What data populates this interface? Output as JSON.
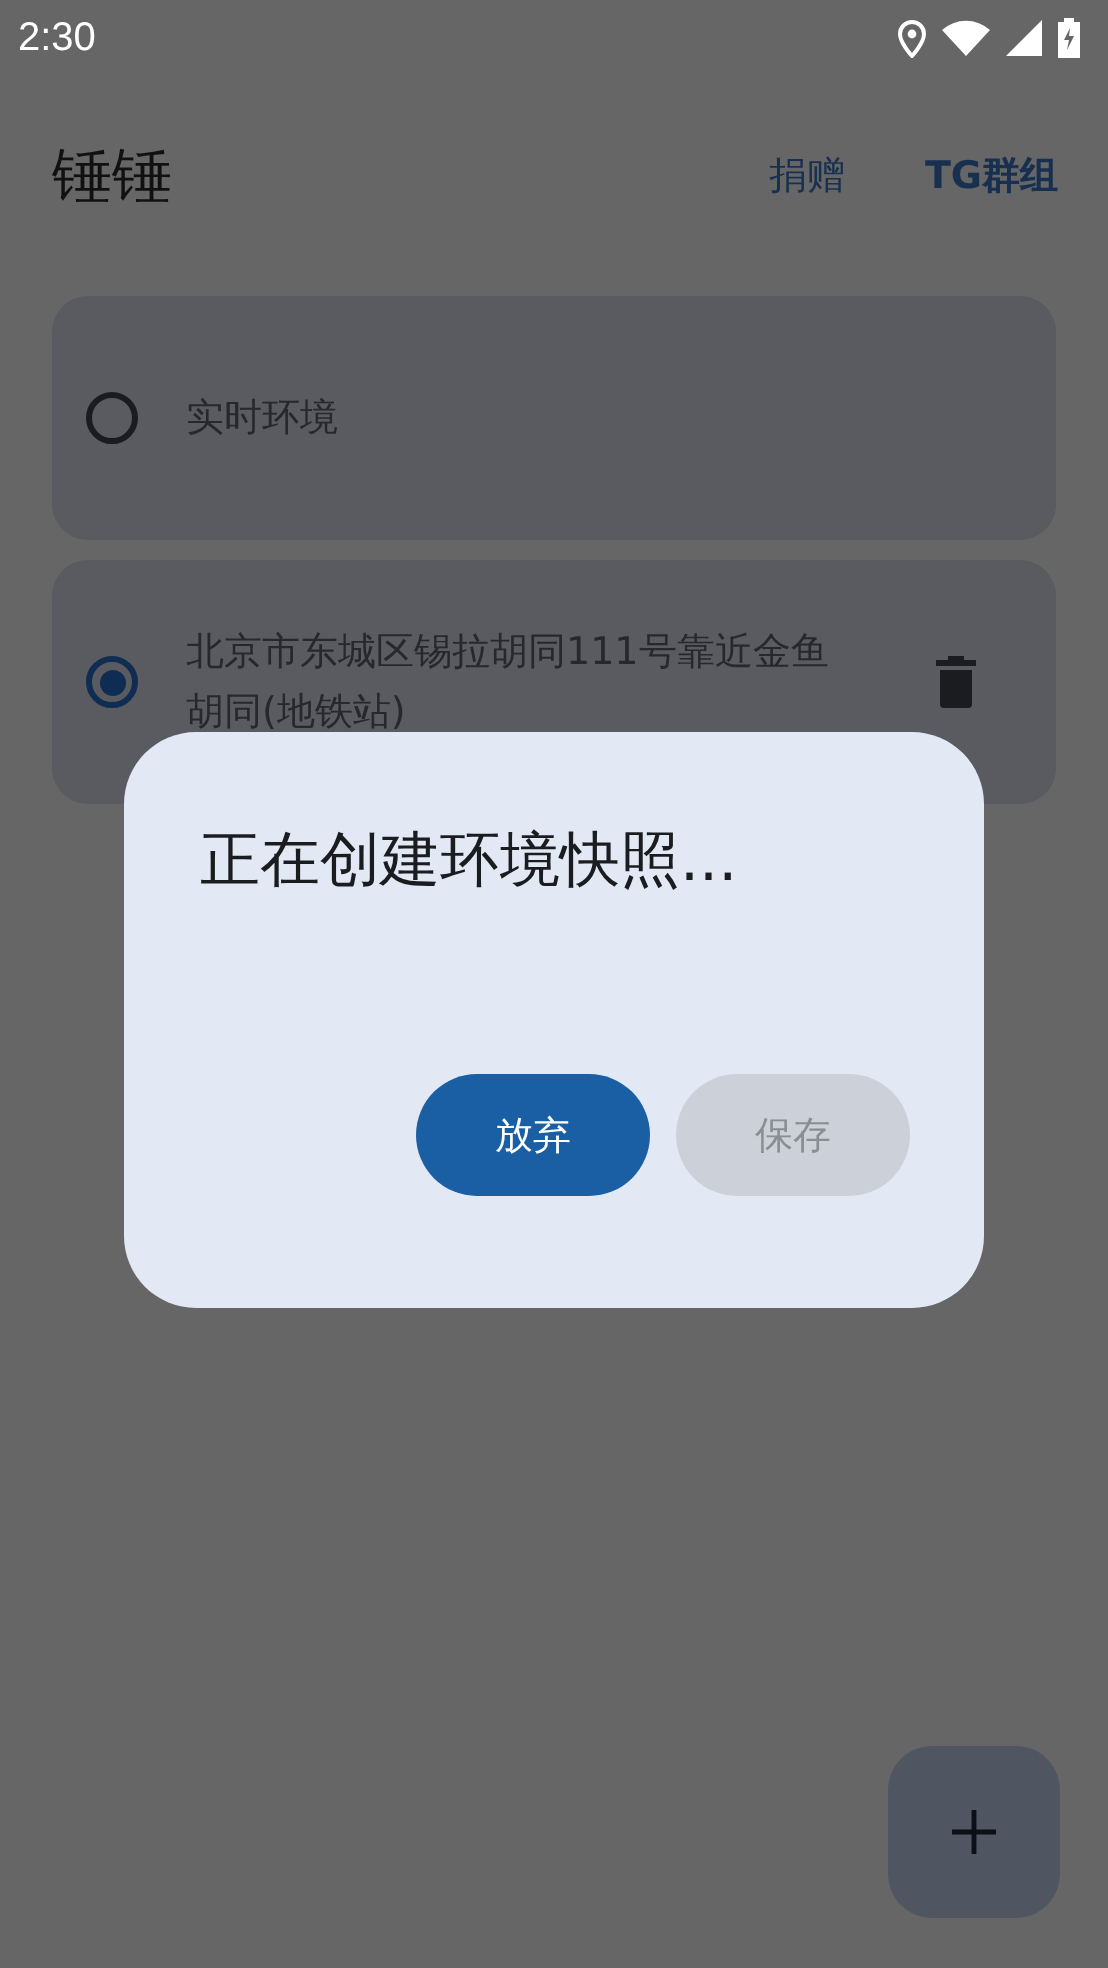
{
  "status_bar": {
    "time": "2:30"
  },
  "app_bar": {
    "title": "锤锤",
    "actions": [
      "捐赠",
      "TG群组"
    ]
  },
  "environments": [
    {
      "label": "实时环境",
      "selected": false,
      "deletable": false
    },
    {
      "label": "北京市东城区锡拉胡同111号靠近金鱼胡同(地铁站)",
      "selected": true,
      "deletable": true
    }
  ],
  "dialog": {
    "title": "正在创建环境快照...",
    "buttons": [
      {
        "label": "放弃",
        "disabled": false
      },
      {
        "label": "保存",
        "disabled": true
      }
    ]
  }
}
